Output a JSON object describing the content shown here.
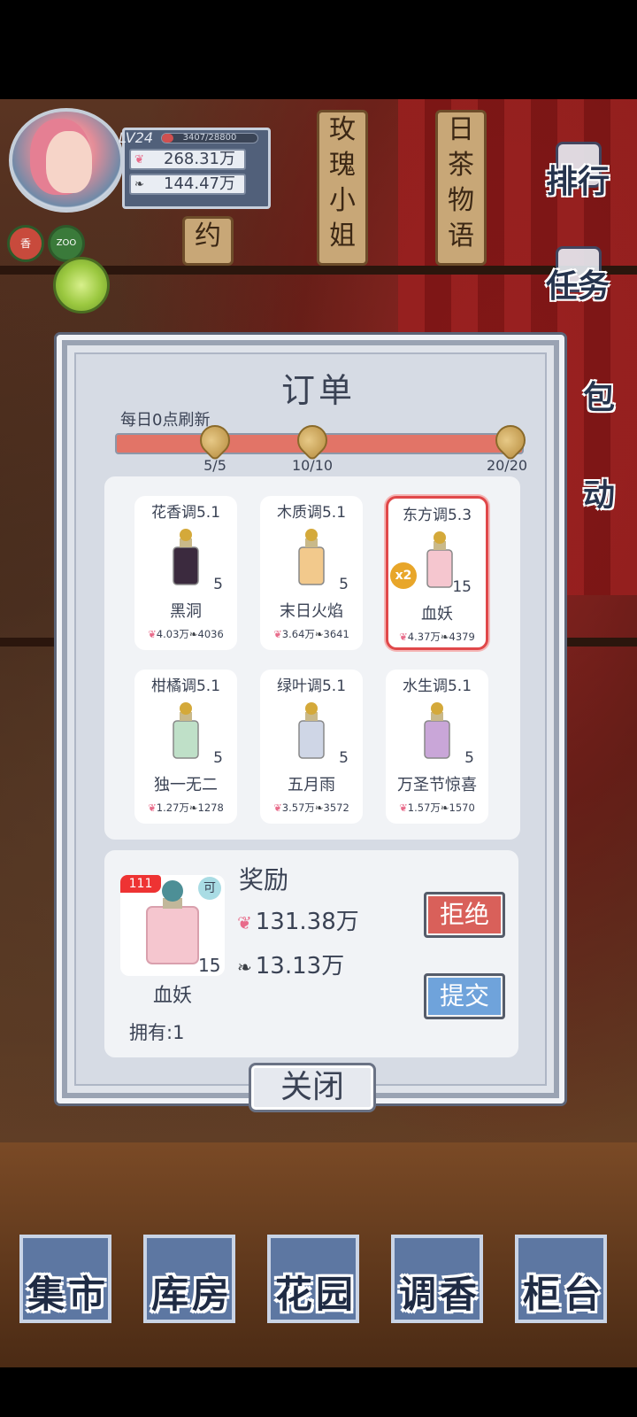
{
  "profile": {
    "level": "LV24",
    "exp": "3407/28800",
    "currency_petal": "268.31万",
    "currency_leaf": "144.47万"
  },
  "side_badges": {
    "badge1": "香",
    "badge2": "ZOO"
  },
  "tags": {
    "tag1": "玫瑰小姐",
    "tag2": "日茶物语",
    "tag3": "约"
  },
  "right_menu": {
    "ranking": "排行",
    "tasks": "任务",
    "bag": "包",
    "activity": "动"
  },
  "dialog": {
    "title": "订单",
    "refresh_label": "每日0点刷新",
    "progress_fraction": 1.0,
    "milestones": [
      "5/5",
      "10/10",
      "20/20"
    ]
  },
  "orders": [
    {
      "category": "花香调5.1",
      "name": "黑洞",
      "qty": "5",
      "petal": "4.03万",
      "leaf": "4036",
      "color": "#3b2a3e",
      "selected": false
    },
    {
      "category": "木质调5.1",
      "name": "末日火焰",
      "qty": "5",
      "petal": "3.64万",
      "leaf": "3641",
      "color": "#f2c98c",
      "selected": false
    },
    {
      "category": "东方调5.3",
      "name": "血妖",
      "qty": "15",
      "petal": "4.37万",
      "leaf": "4379",
      "color": "#f5c6cf",
      "selected": true,
      "multiplier": "x2"
    },
    {
      "category": "柑橘调5.1",
      "name": "独一无二",
      "qty": "5",
      "petal": "1.27万",
      "leaf": "1278",
      "color": "#bfe0c8",
      "selected": false
    },
    {
      "category": "绿叶调5.1",
      "name": "五月雨",
      "qty": "5",
      "petal": "3.57万",
      "leaf": "3572",
      "color": "#cfd6e6",
      "selected": false
    },
    {
      "category": "水生调5.1",
      "name": "万圣节惊喜",
      "qty": "5",
      "petal": "1.57万",
      "leaf": "1570",
      "color": "#c9a6d8",
      "selected": false
    }
  ],
  "reward": {
    "badge_count": "111",
    "badge_ke": "可",
    "item_qty": "15",
    "item_name": "血妖",
    "owned": "拥有:1",
    "title": "奖励",
    "petal": "131.38万",
    "leaf": "13.13万",
    "reject_label": "拒绝",
    "submit_label": "提交"
  },
  "close_label": "关闭",
  "bottom_nav": [
    "集市",
    "库房",
    "花园",
    "调香",
    "柜台"
  ],
  "colors": {
    "accent_red": "#e27467",
    "reject": "#d9605a",
    "submit": "#6fa3db",
    "text": "#3a4254"
  }
}
